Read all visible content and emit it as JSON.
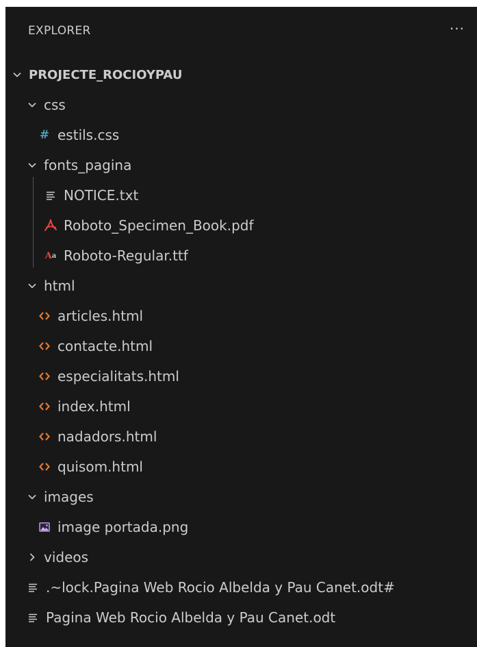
{
  "explorer": {
    "title": "EXPLORER",
    "more_label": "···"
  },
  "tree": {
    "root": "PROJECTE_ROCIOYPAU",
    "css_folder": "css",
    "css_files": [
      "estils.css"
    ],
    "fonts_folder": "fonts_pagina",
    "fonts_files": [
      "NOTICE.txt",
      "Roboto_Specimen_Book.pdf",
      "Roboto-Regular.ttf"
    ],
    "html_folder": "html",
    "html_files": [
      "articles.html",
      "contacte.html",
      "especialitats.html",
      "index.html",
      "nadadors.html",
      "quisom.html"
    ],
    "images_folder": "images",
    "images_files": [
      "image portada.png"
    ],
    "videos_folder": "videos",
    "root_files": [
      ".~lock.Pagina Web Rocio Albelda y Pau Canet.odt#",
      "Pagina Web Rocio Albelda y Pau Canet.odt"
    ]
  },
  "icons": {
    "css": "hash-icon",
    "txt": "lines-icon",
    "pdf": "pdf-icon",
    "ttf": "font-icon",
    "html": "code-brackets-icon",
    "png": "image-icon",
    "expanded": "chevron-down-icon",
    "collapsed": "chevron-right-icon"
  },
  "colors": {
    "background": "#181818",
    "text": "#cccccc",
    "css_icon": "#519aba",
    "html_icon": "#e37933",
    "pdf_icon": "#e5473f",
    "ttf_icon": "#e5473f",
    "png_icon": "#a074c4",
    "guide": "#555555"
  }
}
